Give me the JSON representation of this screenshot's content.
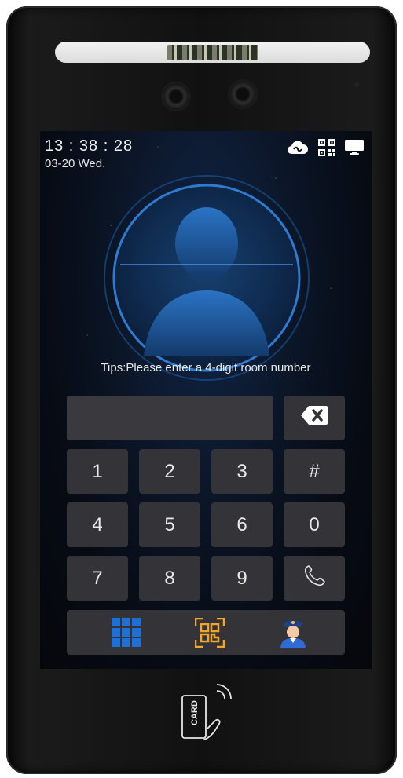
{
  "status": {
    "time": "13 : 38 : 28",
    "date": "03-20 Wed.",
    "icons": [
      "cloud-link-icon",
      "qr-code-icon",
      "monitor-icon"
    ]
  },
  "face": {
    "icon": "face-silhouette-icon"
  },
  "tips": "Tips:Please enter a 4-digit room number",
  "input": {
    "value": ""
  },
  "keypad": {
    "backspace_icon": "backspace-icon",
    "keys": [
      "1",
      "2",
      "3",
      "#",
      "4",
      "5",
      "6",
      "0",
      "7",
      "8",
      "9"
    ],
    "call_icon": "phone-call-icon"
  },
  "bottom_bar": {
    "items": [
      "keypad-grid-icon",
      "qr-scan-icon",
      "guard-avatar-icon"
    ]
  },
  "card_reader": {
    "label": "CARD"
  },
  "colors": {
    "accent_blue": "#1e6fd6",
    "qr_orange": "#f5a623",
    "key_bg": "#333338"
  }
}
